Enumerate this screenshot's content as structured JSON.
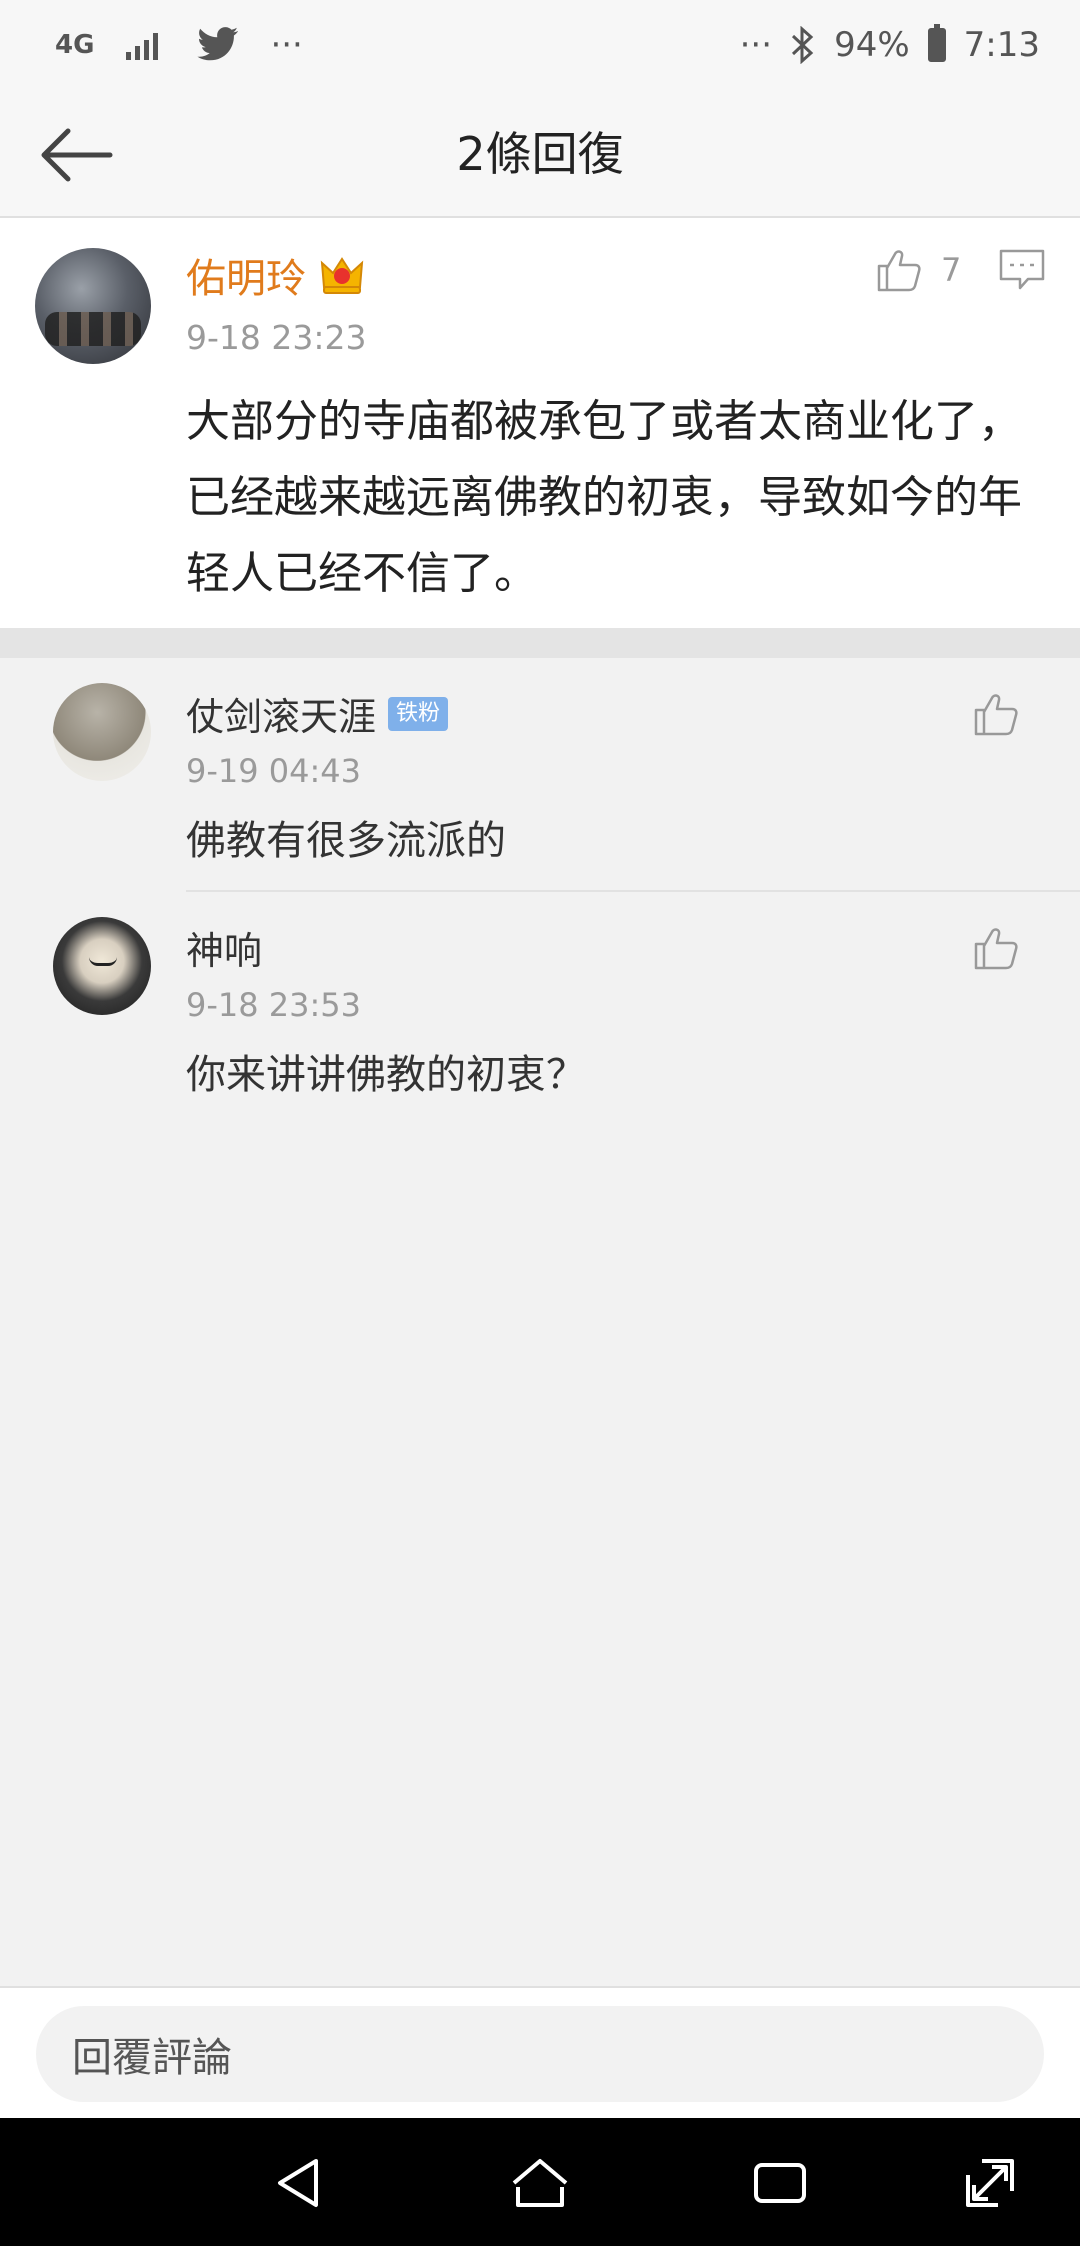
{
  "status_bar": {
    "network_label": "4G",
    "signal_icon": "signal-bars-icon",
    "app_icon": "twitter-bird-icon",
    "more_left": "···",
    "more_right": "···",
    "bluetooth_icon": "bluetooth-icon",
    "battery": "94%",
    "time": "7:13"
  },
  "header": {
    "title": "2條回復",
    "back_icon": "back-arrow-icon"
  },
  "main_comment": {
    "username": "佑明玲",
    "badge_icon": "crown-icon",
    "time": "9-18 23:23",
    "text": "大部分的寺庙都被承包了或者太商业化了，已经越来越远离佛教的初衷，导致如今的年轻人已经不信了。",
    "likes": "7"
  },
  "replies": [
    {
      "username": "仗剑滚天涯",
      "badge": "铁粉",
      "time": "9-19 04:43",
      "text": "佛教有很多流派的"
    },
    {
      "username": "神响",
      "time": "9-18 23:53",
      "text": "你来讲讲佛教的初衷？"
    }
  ],
  "bottom": {
    "placeholder": "回覆評論"
  },
  "colors": {
    "username_vip": "#e07b1c",
    "badge_bg": "#7fb0ea",
    "timestamp": "#9a9a9a"
  }
}
